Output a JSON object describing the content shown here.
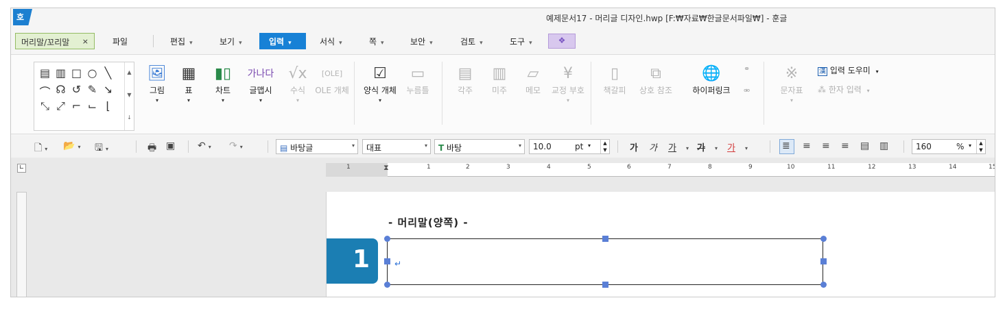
{
  "window": {
    "logo": "호",
    "title": "예제문서17 - 머리글 디자인.hwp [F:₩자료₩한글문서파일₩] - 훈글"
  },
  "menubar": {
    "context_tab": "머리말/꼬리말",
    "context_close": "×",
    "file": "파일",
    "items": [
      "편집",
      "보기",
      "입력",
      "서식",
      "쪽",
      "보안",
      "검토",
      "도구"
    ],
    "active": "입력"
  },
  "ribbon": {
    "buttons": [
      {
        "label": "그림",
        "icon": "picture-icon",
        "enabled": true
      },
      {
        "label": "표",
        "icon": "table-icon",
        "enabled": true
      },
      {
        "label": "차트",
        "icon": "chart-icon",
        "enabled": true
      },
      {
        "label": "글맵시",
        "icon": "textart-icon",
        "enabled": true
      },
      {
        "label": "수식",
        "icon": "formula-icon",
        "enabled": false
      },
      {
        "label": "OLE 개체",
        "icon": "ole-icon",
        "enabled": false
      },
      {
        "label": "양식 개체",
        "icon": "form-icon",
        "enabled": true
      },
      {
        "label": "누름틀",
        "icon": "field-icon",
        "enabled": false
      },
      {
        "label": "각주",
        "icon": "footnote-icon",
        "enabled": false
      },
      {
        "label": "미주",
        "icon": "endnote-icon",
        "enabled": false
      },
      {
        "label": "메모",
        "icon": "memo-icon",
        "enabled": false
      },
      {
        "label": "교정 부호",
        "icon": "proofread-icon",
        "enabled": false
      },
      {
        "label": "책갈피",
        "icon": "bookmark-icon",
        "enabled": false
      },
      {
        "label": "상호 참조",
        "icon": "crossref-icon",
        "enabled": false
      },
      {
        "label": "하이퍼링크",
        "icon": "hyperlink-icon",
        "enabled": true
      },
      {
        "label": "문자표",
        "icon": "symbol-icon",
        "enabled": false
      }
    ],
    "input_helper": "입력 도우미",
    "hanja_input": "한자 입력"
  },
  "toolbar": {
    "style_name": "바탕글",
    "font_lang": "대표",
    "font_name": "바탕",
    "font_size": "10.0",
    "size_unit": "pt",
    "bold": "가",
    "italic": "가",
    "underline": "가",
    "strike": "가",
    "color_text": "가",
    "zoom": "160",
    "zoom_unit": "%"
  },
  "ruler": {
    "ticks": [
      "1",
      "1",
      "2",
      "3",
      "4",
      "5",
      "6",
      "7",
      "8",
      "9",
      "10",
      "11",
      "12",
      "13",
      "14",
      "15"
    ]
  },
  "document": {
    "header_label": "- 머리말(양쪽) -",
    "badge_number": "1",
    "paragraph_mark": "↵"
  },
  "colors": {
    "accent": "#1781d6",
    "badge": "#1b7eb3",
    "handle": "#5a7fd6",
    "context_tab": "#e3f0d2"
  }
}
